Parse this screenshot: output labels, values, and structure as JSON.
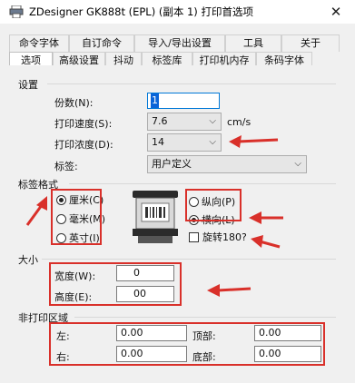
{
  "window": {
    "title": "ZDesigner GK888t (EPL) (副本 1) 打印首选项",
    "close_glyph": "✕"
  },
  "tabs_back": [
    "命令字体",
    "自订命令",
    "导入/导出设置",
    "工具",
    "关于"
  ],
  "tabs_front": [
    "选项",
    "高级设置",
    "抖动",
    "标签库",
    "打印机内存",
    "条码字体"
  ],
  "settings": {
    "group_label": "设置",
    "copies_label": "份数(N):",
    "copies_value": "1",
    "speed_label": "打印速度(S):",
    "speed_value": "7.6",
    "speed_unit": "cm/s",
    "darkness_label": "打印浓度(D):",
    "darkness_value": "14",
    "stock_label": "标签:",
    "stock_value": "用户定义"
  },
  "label_format": {
    "group_label": "标签格式",
    "units": [
      "厘米(C)",
      "毫米(M)",
      "英寸(I)"
    ],
    "selected_unit": "厘米(C)",
    "orientation": [
      "纵向(P)",
      "横向(L)"
    ],
    "selected_orientation": "横向(L)",
    "rotate_label": "旋转180?",
    "rotate_checked": false
  },
  "size": {
    "group_label": "大小",
    "width_label": "宽度(W):",
    "width_value": "0",
    "height_label": "高度(E):",
    "height_value": "00"
  },
  "unprintable": {
    "group_label": "非打印区域",
    "left_label": "左:",
    "left_value": "0.00",
    "top_label": "顶部:",
    "top_value": "0.00",
    "right_label": "右:",
    "right_value": "0.00",
    "bottom_label": "底部:",
    "bottom_value": "0.00"
  },
  "colors": {
    "annotation_red": "#d9302a",
    "focus_blue": "#0078d7"
  },
  "icons": [
    "printer-icon",
    "close-icon",
    "label-printer-illustration"
  ]
}
